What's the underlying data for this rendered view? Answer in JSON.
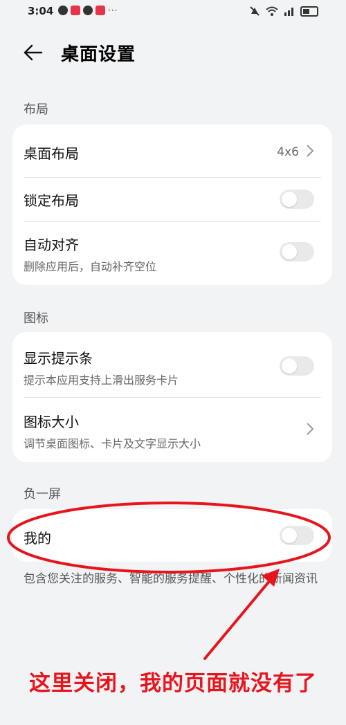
{
  "status_bar": {
    "time": "3:04",
    "dots": "···",
    "icons": [
      "wechat-icon",
      "app-icon",
      "qq-icon",
      "app-icon",
      "mute-icon",
      "wifi-icon",
      "signal-icon",
      "battery-icon"
    ]
  },
  "header": {
    "title": "桌面设置",
    "back_icon": "back-arrow-icon"
  },
  "sections": {
    "layout": {
      "label": "布局",
      "rows": {
        "desktop_layout": {
          "title": "桌面布局",
          "value": "4x6"
        },
        "lock_layout": {
          "title": "锁定布局"
        },
        "auto_align": {
          "title": "自动对齐",
          "subtitle": "删除应用后，自动补齐空位"
        }
      }
    },
    "icons": {
      "label": "图标",
      "rows": {
        "hint_bar": {
          "title": "显示提示条",
          "subtitle": "提示本应用支持上滑出服务卡片"
        },
        "icon_size": {
          "title": "图标大小",
          "subtitle": "调节桌面图标、卡片及文字显示大小"
        }
      }
    },
    "minus_one": {
      "label": "负一屏",
      "rows": {
        "mine": {
          "title": "我的"
        }
      },
      "footnote": "包含您关注的服务、智能的服务提醒、个性化的新闻资讯"
    }
  },
  "annotation": {
    "text": "这里关闭，我的页面就没有了",
    "color": "#e8141c"
  },
  "colors": {
    "background": "#f1f3f5",
    "card": "#ffffff",
    "toggle_off": "#e8e9eb"
  }
}
